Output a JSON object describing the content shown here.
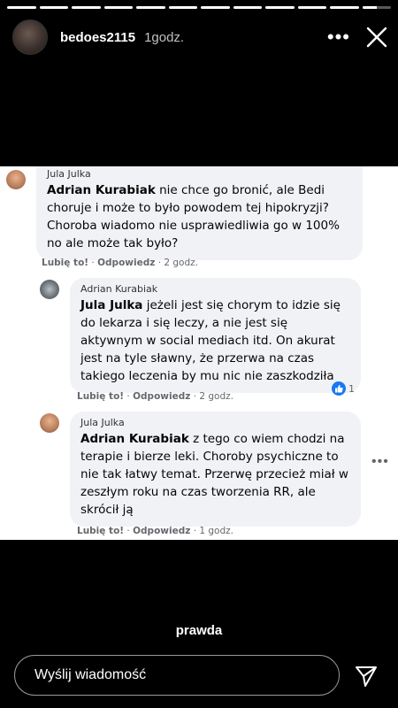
{
  "story": {
    "progress": [
      1,
      1,
      1,
      1,
      1,
      1,
      1,
      1,
      1,
      1,
      1,
      0.5
    ],
    "username": "bedoes2115",
    "time_ago": "1godz.",
    "more_label": "•••",
    "caption": "prawda",
    "message_placeholder": "Wyślij wiadomość"
  },
  "post": {
    "comments": [
      {
        "author": "Jula Julka",
        "mention": "Adrian Kurabiak",
        "text": " nie chce go bronić, ale Bedi choruje i może to było powodem tej hipokryzji? Choroba wiadomo nie usprawiedliwia go w 100% no ale może tak było?",
        "like_label": "Lubię to!",
        "reply_label": "Odpowiedz",
        "time": "· 2 godz."
      },
      {
        "author": "Adrian Kurabiak",
        "mention": "Jula Julka",
        "text": " jeżeli jest się chorym to idzie się do lekarza i się leczy, a nie jest się aktywnym w social mediach itd. On akurat jest na tyle sławny, że przerwa na czas takiego leczenia by mu nic nie zaszkodziła",
        "like_label": "Lubię to!",
        "reply_label": "Odpowiedz",
        "time": "· 2 godz.",
        "reaction_count": "1"
      },
      {
        "author": "Jula Julka",
        "mention": "Adrian Kurabiak",
        "text": " z tego co wiem chodzi na terapie i bierze leki. Choroby psychiczne to nie tak łatwy temat. Przerwę przecież miał w zeszłym roku na czas tworzenia RR, ale skrócił ją",
        "like_label": "Lubię to!",
        "reply_label": "Odpowiedz",
        "time": "· 1 godz."
      }
    ],
    "separator": " · "
  },
  "icons": {
    "close": "close-icon",
    "send": "paper-plane-icon",
    "more": "more-horizontal-icon",
    "like": "thumbs-up-icon",
    "comment_options": "more-horizontal-icon"
  },
  "colors": {
    "like_blue": "#1877f2",
    "bubble": "#f0f2f5",
    "meta_grey": "#65676b"
  }
}
